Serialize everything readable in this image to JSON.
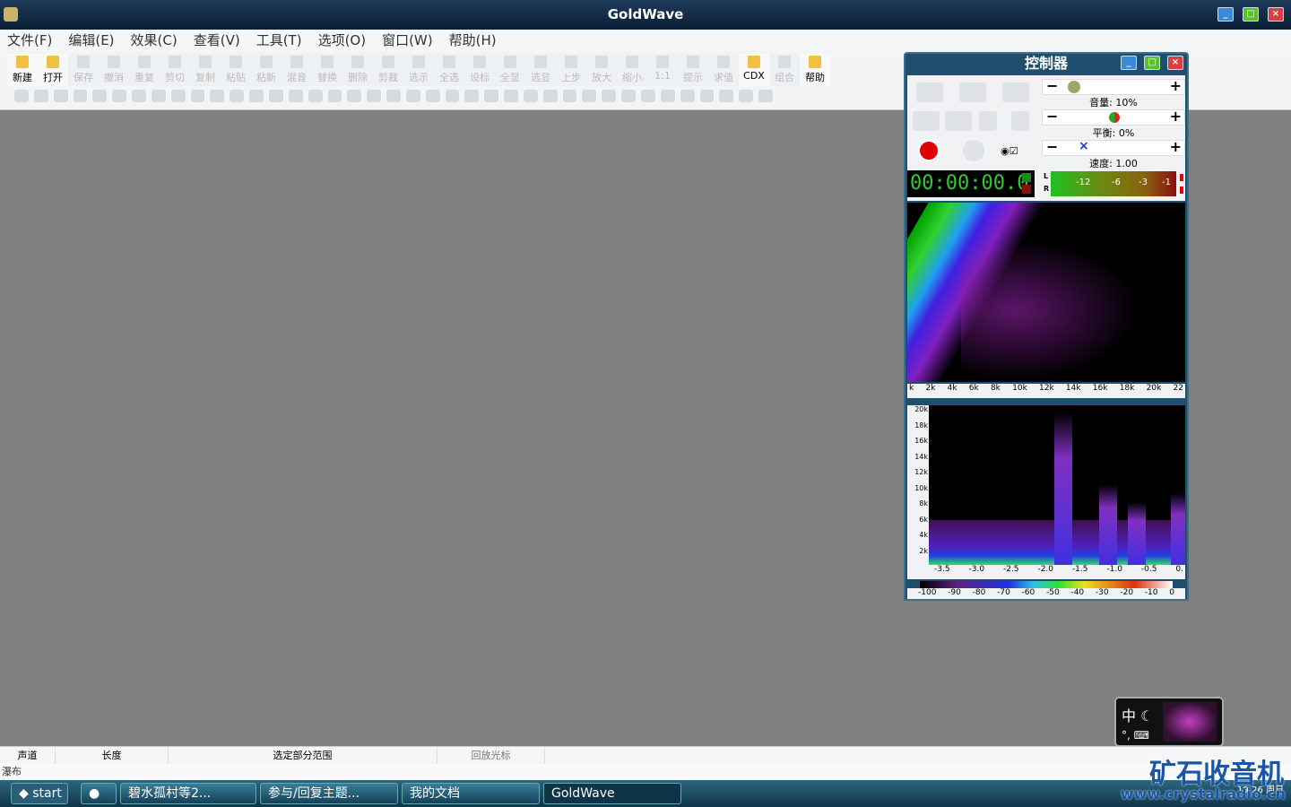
{
  "window": {
    "title": "GoldWave"
  },
  "menu": [
    "文件(F)",
    "编辑(E)",
    "效果(C)",
    "查看(V)",
    "工具(T)",
    "选项(O)",
    "窗口(W)",
    "帮助(H)"
  ],
  "toolbar": [
    {
      "label": "新建",
      "enabled": true
    },
    {
      "label": "打开",
      "enabled": true
    },
    {
      "label": "保存",
      "enabled": false
    },
    {
      "label": "撤消",
      "enabled": false
    },
    {
      "label": "重复",
      "enabled": false
    },
    {
      "label": "剪切",
      "enabled": false
    },
    {
      "label": "复制",
      "enabled": false
    },
    {
      "label": "粘贴",
      "enabled": false
    },
    {
      "label": "粘新",
      "enabled": false
    },
    {
      "label": "混音",
      "enabled": false
    },
    {
      "label": "替换",
      "enabled": false
    },
    {
      "label": "删除",
      "enabled": false
    },
    {
      "label": "剪裁",
      "enabled": false
    },
    {
      "label": "选示",
      "enabled": false
    },
    {
      "label": "全选",
      "enabled": false
    },
    {
      "label": "设标",
      "enabled": false
    },
    {
      "label": "全显",
      "enabled": false
    },
    {
      "label": "选显",
      "enabled": false
    },
    {
      "label": "上步",
      "enabled": false
    },
    {
      "label": "放大",
      "enabled": false
    },
    {
      "label": "缩小",
      "enabled": false
    },
    {
      "label": "1:1",
      "enabled": false
    },
    {
      "label": "提示",
      "enabled": false
    },
    {
      "label": "求值",
      "enabled": false
    },
    {
      "label": "CDX",
      "enabled": true
    },
    {
      "label": "组合",
      "enabled": false
    },
    {
      "label": "帮助",
      "enabled": true
    }
  ],
  "status": {
    "channel": "声道",
    "length": "长度",
    "selection": "选定部分范围",
    "cursor": "回放光标",
    "line2": "瀑布"
  },
  "controller": {
    "title": "控制器",
    "volume": "音量: 10%",
    "balance": "平衡: 0%",
    "speed": "速度: 1.00",
    "time": "00:00:00.0",
    "meter_labels": [
      "L",
      "R"
    ],
    "meter_ticks": [
      "-12",
      "-6",
      "-3",
      "-1"
    ],
    "freq_ticks": [
      "k",
      "2k",
      "4k",
      "6k",
      "8k",
      "10k",
      "12k",
      "14k",
      "16k",
      "18k",
      "20k",
      "22"
    ],
    "y_ticks": [
      "20k",
      "18k",
      "16k",
      "14k",
      "12k",
      "10k",
      "8k",
      "6k",
      "4k",
      "2k"
    ],
    "time_ticks": [
      "-3.5",
      "-3.0",
      "-2.5",
      "-2.0",
      "-1.5",
      "-1.0",
      "-0.5",
      "0."
    ],
    "db_ticks": [
      "-100",
      "-90",
      "-80",
      "-70",
      "-60",
      "-50",
      "-40",
      "-30",
      "-20",
      "-10",
      "0"
    ]
  },
  "ime": {
    "label": "中"
  },
  "taskbar": {
    "start": "start",
    "tasks": [
      "碧水孤村等2...",
      "参与/回复主题...",
      "我的文档",
      "GoldWave"
    ],
    "clock": "19:26 周日"
  },
  "watermark": {
    "brand": "矿石收音机",
    "url": "www.crystalradio.cn"
  }
}
